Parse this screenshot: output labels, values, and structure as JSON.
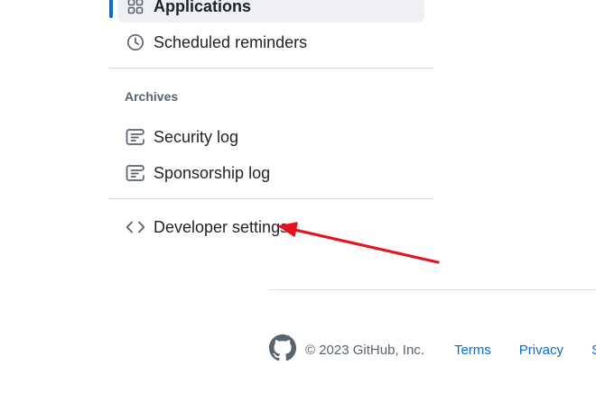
{
  "sidebar": {
    "items": [
      {
        "label": "Applications",
        "icon": "apps-grid-icon",
        "active": true
      },
      {
        "label": "Scheduled reminders",
        "icon": "clock-icon"
      }
    ],
    "archives": {
      "heading": "Archives",
      "items": [
        {
          "label": "Security log",
          "icon": "log-icon"
        },
        {
          "label": "Sponsorship log",
          "icon": "log-icon"
        }
      ]
    },
    "developer": {
      "label": "Developer settings",
      "icon": "code-icon"
    }
  },
  "footer": {
    "copyright": "© 2023 GitHub, Inc.",
    "links": [
      "Terms",
      "Privacy",
      "Se"
    ]
  },
  "annotation": {
    "arrow_color": "#e5141c"
  },
  "colors": {
    "accent": "#0969da",
    "text": "#1f2328",
    "muted": "#59636e"
  }
}
